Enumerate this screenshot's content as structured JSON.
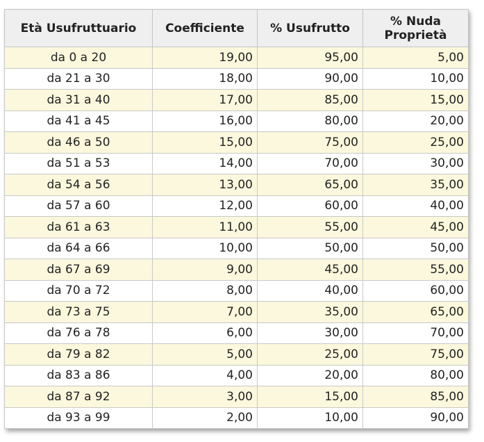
{
  "table": {
    "headers": [
      "Età Usufruttuario",
      "Coefficiente",
      "% Usufrutto",
      "% Nuda Proprietà"
    ],
    "rows": [
      [
        "da 0 a 20",
        "19,00",
        "95,00",
        "5,00"
      ],
      [
        "da 21 a 30",
        "18,00",
        "90,00",
        "10,00"
      ],
      [
        "da 31 a 40",
        "17,00",
        "85,00",
        "15,00"
      ],
      [
        "da 41 a 45",
        "16,00",
        "80,00",
        "20,00"
      ],
      [
        "da 46 a 50",
        "15,00",
        "75,00",
        "25,00"
      ],
      [
        "da 51 a 53",
        "14,00",
        "70,00",
        "30,00"
      ],
      [
        "da 54 a 56",
        "13,00",
        "65,00",
        "35,00"
      ],
      [
        "da 57 a 60",
        "12,00",
        "60,00",
        "40,00"
      ],
      [
        "da 61 a 63",
        "11,00",
        "55,00",
        "45,00"
      ],
      [
        "da 64 a 66",
        "10,00",
        "50,00",
        "50,00"
      ],
      [
        "da 67 a 69",
        "9,00",
        "45,00",
        "55,00"
      ],
      [
        "da 70 a 72",
        "8,00",
        "40,00",
        "60,00"
      ],
      [
        "da 73 a 75",
        "7,00",
        "35,00",
        "65,00"
      ],
      [
        "da 76 a 78",
        "6,00",
        "30,00",
        "70,00"
      ],
      [
        "da 79 a 82",
        "5,00",
        "25,00",
        "75,00"
      ],
      [
        "da 83 a 86",
        "4,00",
        "20,00",
        "80,00"
      ],
      [
        "da 87 a 92",
        "3,00",
        "15,00",
        "85,00"
      ],
      [
        "da 93 a 99",
        "2,00",
        "10,00",
        "90,00"
      ]
    ]
  },
  "colors": {
    "header_bg": "#efefef",
    "row_alt_bg": "#fcf8dd",
    "row_bg": "#ffffff",
    "border": "#c8c8c8",
    "text": "#222222"
  }
}
